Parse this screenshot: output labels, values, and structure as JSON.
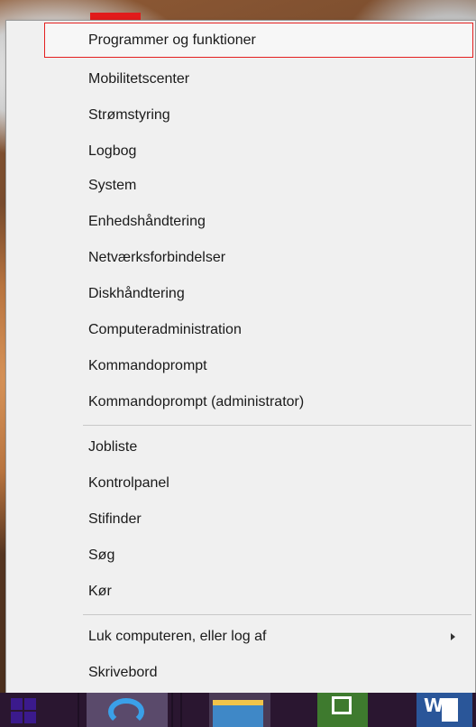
{
  "menu": {
    "items": [
      {
        "label": "Programmer og funktioner"
      },
      {
        "label": "Mobilitetscenter"
      },
      {
        "label": "Strømstyring"
      },
      {
        "label": "Logbog"
      },
      {
        "label": "System"
      },
      {
        "label": "Enhedshåndtering"
      },
      {
        "label": "Netværksforbindelser"
      },
      {
        "label": "Diskhåndtering"
      },
      {
        "label": "Computeradministration"
      },
      {
        "label": "Kommandoprompt"
      },
      {
        "label": "Kommandoprompt (administrator)"
      },
      {
        "label": "Jobliste"
      },
      {
        "label": "Kontrolpanel"
      },
      {
        "label": "Stifinder"
      },
      {
        "label": "Søg"
      },
      {
        "label": "Kør"
      },
      {
        "label": "Luk computeren, eller log af"
      },
      {
        "label": "Skrivebord"
      }
    ]
  },
  "taskbar": {
    "word_glyph": "W"
  },
  "colors": {
    "highlight_border": "#e42020",
    "menu_background": "#f0f0f0",
    "taskbar": "#2a1630"
  },
  "icons": {
    "start": "windows-logo-icon",
    "ie": "internet-explorer-icon",
    "explorer": "file-explorer-icon",
    "store": "store-icon",
    "word": "word-icon",
    "submenu_arrow": "submenu-arrow-icon"
  }
}
